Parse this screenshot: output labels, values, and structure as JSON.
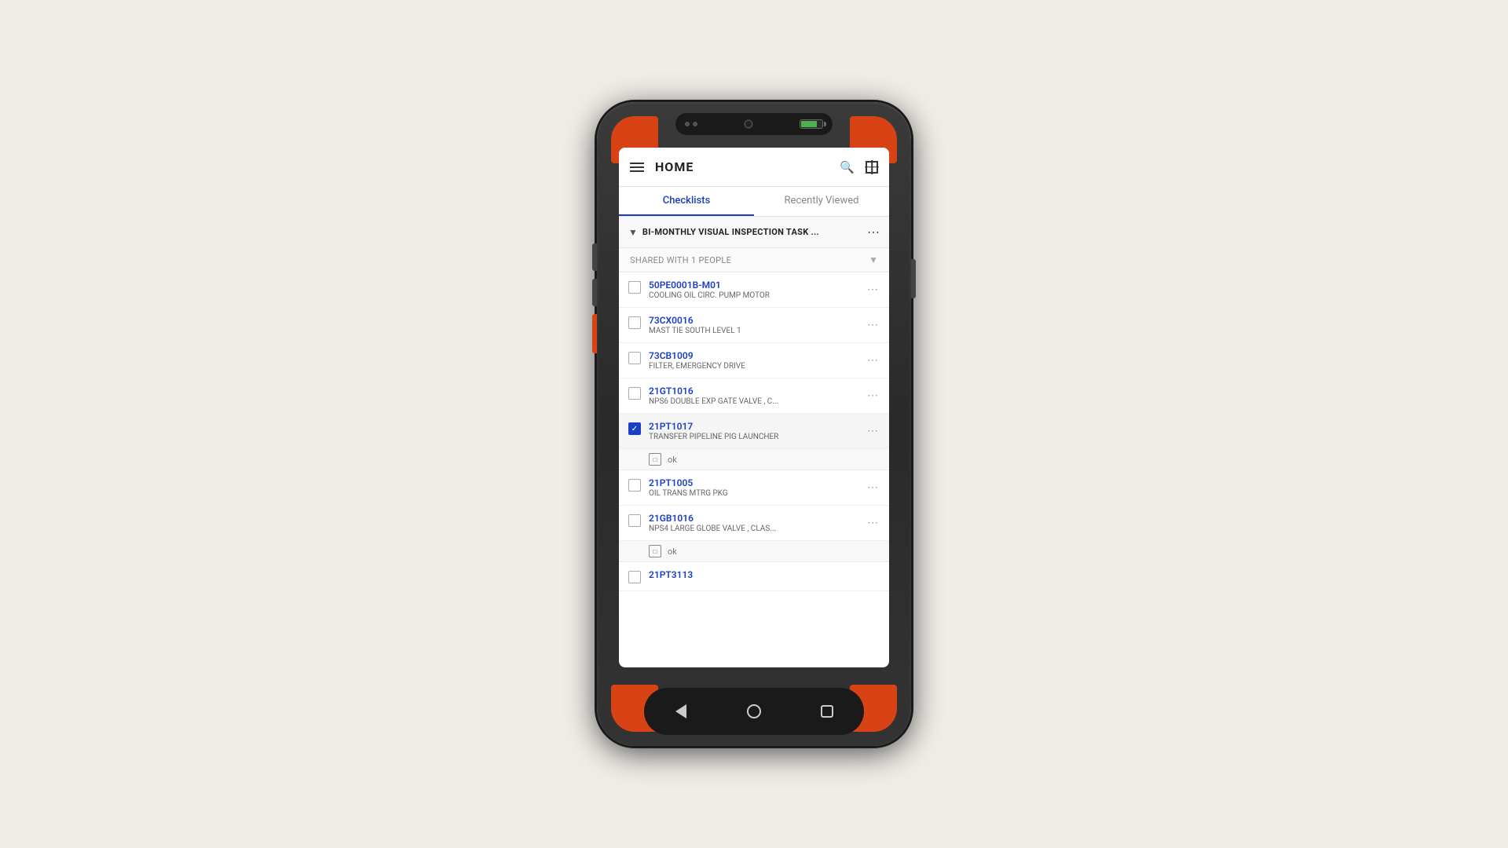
{
  "device": {
    "shell_color": "#2a2a2a",
    "accent_color": "#d84315"
  },
  "app": {
    "title": "HOME",
    "tabs": [
      {
        "id": "checklists",
        "label": "Checklists",
        "active": true
      },
      {
        "id": "recently-viewed",
        "label": "Recently Viewed",
        "active": false
      }
    ],
    "section": {
      "title": "BI-MONTHLY VISUAL INSPECTION TASK ...",
      "shared_label": "SHARED WITH 1 PEOPLE"
    },
    "checklist_items": [
      {
        "id": "50PE0001B-M01",
        "desc": "COOLING OIL CIRC. PUMP MOTOR",
        "checked": false,
        "has_ok": false
      },
      {
        "id": "73CX0016",
        "desc": "MAST TIE SOUTH LEVEL 1",
        "checked": false,
        "has_ok": false
      },
      {
        "id": "73CB1009",
        "desc": "FILTER, EMERGENCY DRIVE",
        "checked": false,
        "has_ok": false
      },
      {
        "id": "21GT1016",
        "desc": "NPS6 DOUBLE EXP GATE VALVE , C...",
        "checked": false,
        "has_ok": false
      },
      {
        "id": "21PT1017",
        "desc": "TRANSFER PIPELINE PIG LAUNCHER",
        "checked": true,
        "has_ok": true,
        "ok_label": "ok"
      },
      {
        "id": "21PT1005",
        "desc": "OIL TRANS MTRG PKG",
        "checked": false,
        "has_ok": false
      },
      {
        "id": "21GB1016",
        "desc": "NPS4 LARGE GLOBE VALVE , CLAS...",
        "checked": false,
        "has_ok": true,
        "ok_label": "ok"
      },
      {
        "id": "21PT3113",
        "desc": "",
        "checked": false,
        "has_ok": false
      }
    ]
  },
  "nav": {
    "back_label": "back",
    "home_label": "home",
    "recents_label": "recents"
  }
}
